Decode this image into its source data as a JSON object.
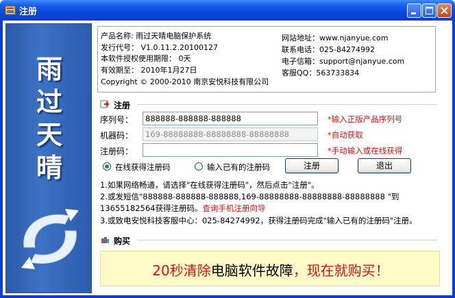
{
  "window": {
    "title": "注册"
  },
  "banner": {
    "chars": [
      "雨",
      "过",
      "天",
      "晴"
    ]
  },
  "info": {
    "product_name": "产品名称: 雨过天晴电脑保护系统",
    "release_code": "发行代号： V1.0.11.2.20100127",
    "license_period": "本软件授权使用期限：   0天",
    "expiry": "有效期至：  2010年1月27日",
    "copyright": "Copyright © 2000-2010 南京安悦科技有限公司",
    "website": "网站地址：www.njanyue.com",
    "phone": "联系电话：025-84274992",
    "email": "电子信箱：support@njanyue.com",
    "qq": "客服QQ：563733834"
  },
  "register": {
    "section_title": "注册",
    "serial_label": "序列号：",
    "serial_value": "888888-888888-888888",
    "serial_hint": "*输入正版产品序列号",
    "machine_label": "机器码：",
    "machine_value": "169-88888888-88888888-88888888",
    "machine_hint": "*自动获取",
    "regcode_label": "注册码：",
    "regcode_value": "",
    "regcode_hint": "*手动输入或在线获得",
    "radio_online": "在线获得注册码",
    "radio_manual": "输入已有的注册码",
    "register_button": "注册",
    "exit_button": "退出"
  },
  "notes": {
    "line1": "1.如果网络畅通，请选择\"在线获得注册码\"，然后点击\"注册\"。",
    "line2": "2.或发短信\"888888-888888-888888,169-88888888-88888888-88888888 \"到",
    "line3_prefix": "13655182564获得注册码。",
    "line3_link": "查询手机注册向导",
    "line4": "3.或致电安悦科技客服中心：025-84274992，获得注册码完成\"输入已有的注册码\"注册。"
  },
  "buy": {
    "section_title": "购买",
    "text_a": "20秒清除",
    "text_b": "电脑软件故障",
    "text_c": "，现在就购买！"
  },
  "colors": {
    "title_bar": "#0a48de",
    "banner": "#3d72c4",
    "hint_red": "#cc1111",
    "buy_bg": "#fffbc8"
  }
}
